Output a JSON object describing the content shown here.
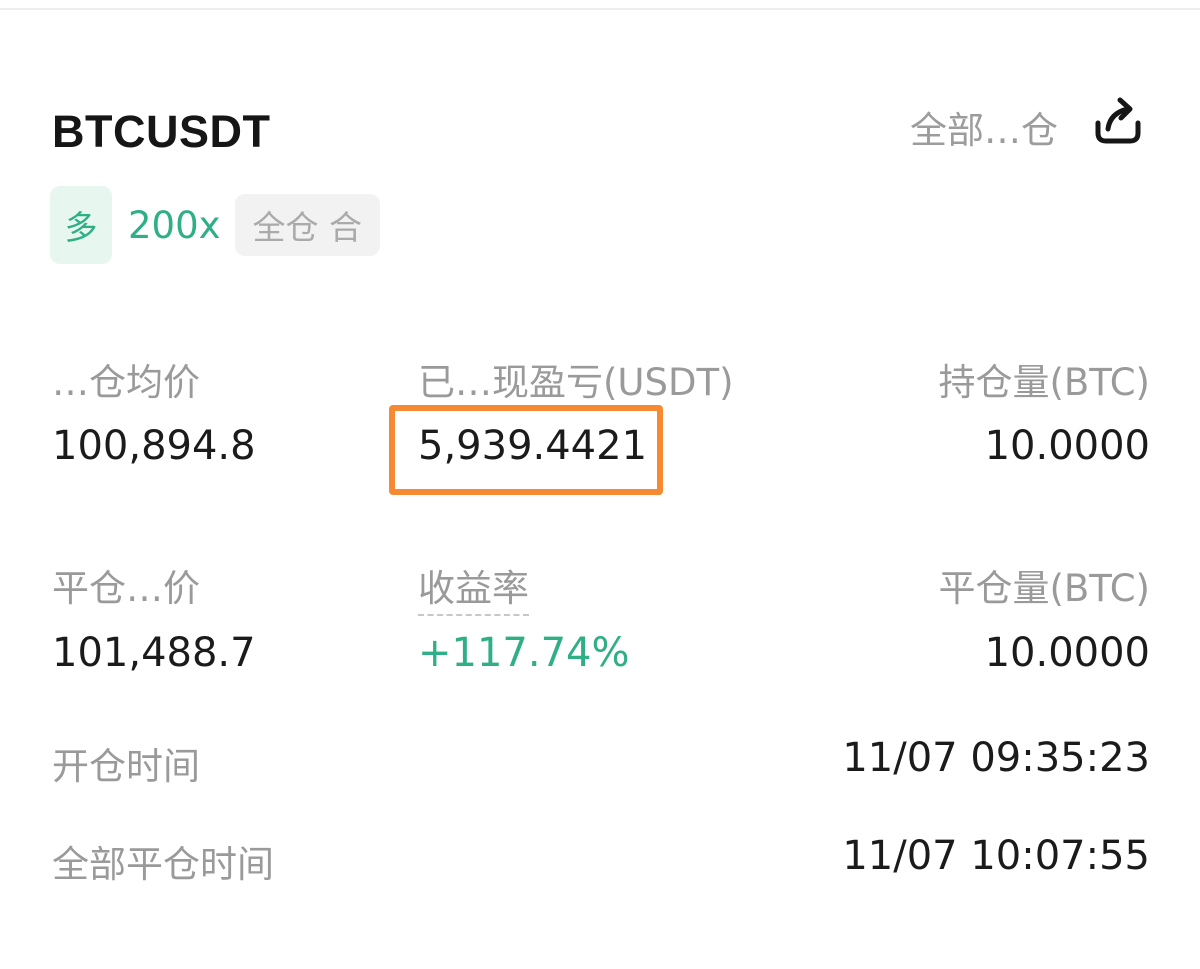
{
  "position": {
    "symbol": "BTCUSDT",
    "header_right_label": "全部…仓",
    "side": "多",
    "leverage": "200x",
    "margin_mode": "全仓 合"
  },
  "metrics": {
    "avg_open_price_label": "…仓均价",
    "avg_open_price": "100,894.8",
    "realized_pnl_label": "已…现盈亏(USDT)",
    "realized_pnl": "5,939.4421",
    "position_size_label": "持仓量(BTC)",
    "position_size": "10.0000",
    "close_price_label": "平仓…价",
    "close_price": "101,488.7",
    "roi_label": "收益率",
    "roi": "+117.74%",
    "closed_size_label": "平仓量(BTC)",
    "closed_size": "10.0000"
  },
  "times": {
    "open_time_label": "开仓时间",
    "open_time": "11/07 09:35:23",
    "close_time_label": "全部平仓时间",
    "close_time": "11/07 10:07:55"
  },
  "colors": {
    "profit_green": "#2faf86",
    "highlight_orange": "#f58a33",
    "label_gray": "#9a9a9a"
  },
  "icons": {
    "share": "share-icon"
  }
}
